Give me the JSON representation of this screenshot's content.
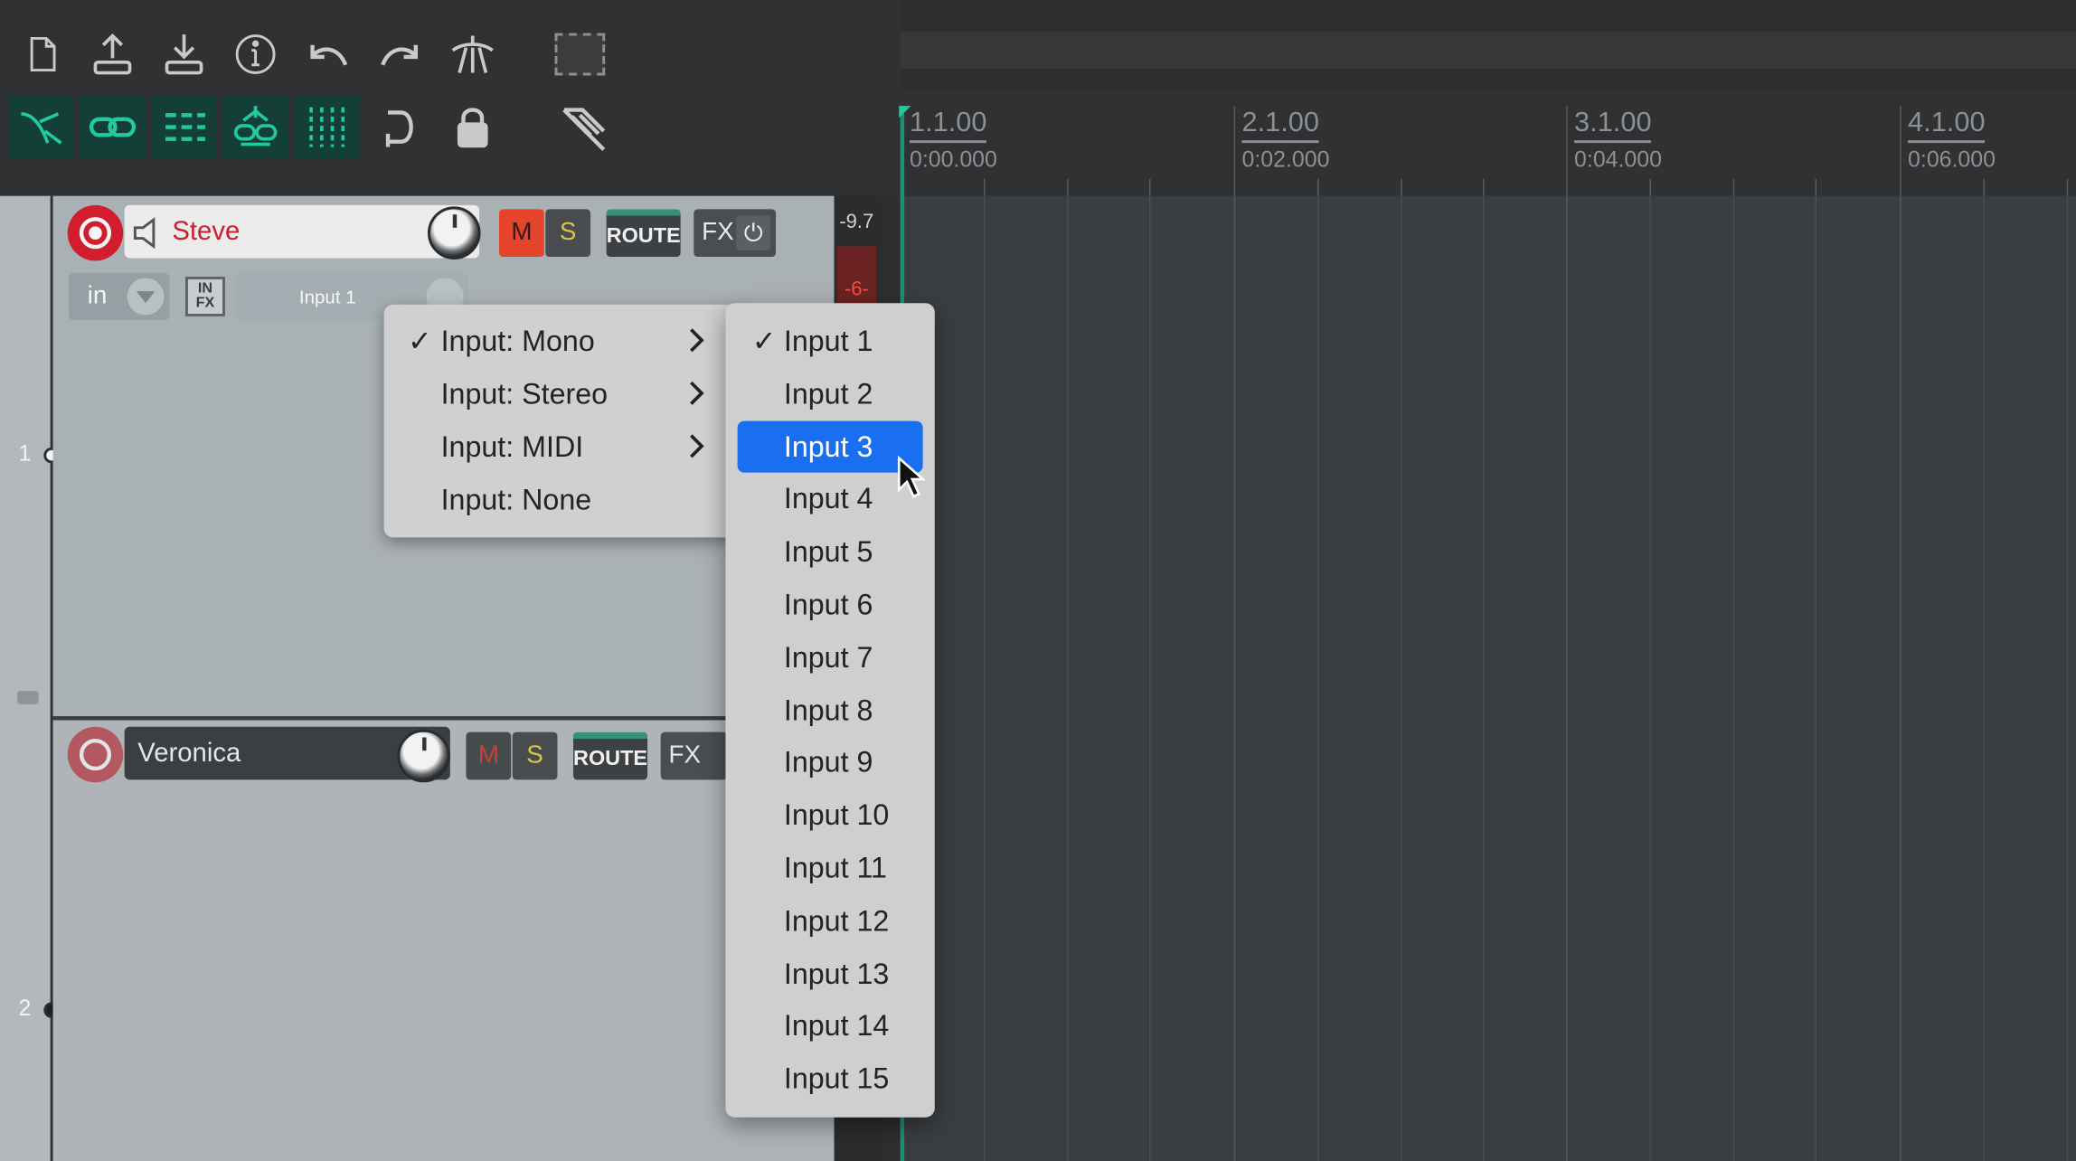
{
  "ruler": {
    "markers": [
      {
        "bar": "1.1.00",
        "time": "0:00.000"
      },
      {
        "bar": "2.1.00",
        "time": "0:02.000"
      },
      {
        "bar": "3.1.00",
        "time": "0:04.000"
      },
      {
        "bar": "4.1.00",
        "time": "0:06.000"
      }
    ]
  },
  "toolbar": {
    "row1": [
      "new-project-icon",
      "open-project-icon",
      "save-project-icon",
      "project-info-icon",
      "undo-icon",
      "redo-icon",
      "metronome-icon"
    ],
    "row2": [
      "ripple-edit-icon",
      "item-grouping-icon",
      "snap-grid-icon",
      "auto-crossfade-icon",
      "grid-lines-icon",
      "loop-icon",
      "lock-icon"
    ],
    "accent": "#22c9a0"
  },
  "tracks": [
    {
      "number": "1",
      "name": "Steve",
      "armed": true,
      "mute_label": "M",
      "solo_label": "S",
      "route_label": "ROUTE",
      "fx_label": "FX",
      "input_mode_label": "in",
      "infx_label": "IN FX",
      "input_label": "Input 1"
    },
    {
      "number": "2",
      "name": "Veronica",
      "armed": false,
      "mute_label": "M",
      "solo_label": "S",
      "route_label": "ROUTE",
      "fx_label": "FX"
    }
  ],
  "meter": {
    "peak": "-9.7",
    "clip": "-6-"
  },
  "input_menu": {
    "items": [
      {
        "label": "Input: Mono",
        "checked": true,
        "submenu": true
      },
      {
        "label": "Input: Stereo",
        "checked": false,
        "submenu": true
      },
      {
        "label": "Input: MIDI",
        "checked": false,
        "submenu": true
      },
      {
        "label": "Input: None",
        "checked": false,
        "submenu": false
      }
    ]
  },
  "mono_submenu": {
    "selected": "Input 1",
    "highlighted": "Input 3",
    "items": [
      "Input 1",
      "Input 2",
      "Input 3",
      "Input 4",
      "Input 5",
      "Input 6",
      "Input 7",
      "Input 8",
      "Input 9",
      "Input 10",
      "Input 11",
      "Input 12",
      "Input 13",
      "Input 14",
      "Input 15"
    ]
  },
  "colors": {
    "record_arm": "#d21d2e",
    "highlight": "#1a6ef0",
    "mute_on": "#e5432c"
  }
}
